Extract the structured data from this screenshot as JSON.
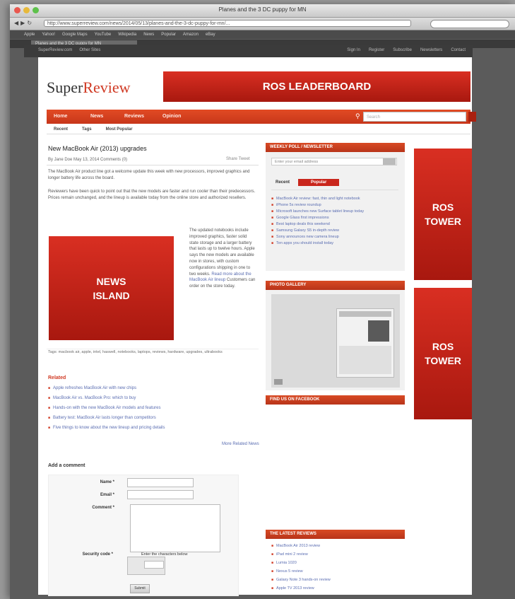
{
  "browser": {
    "window_title": "Planes and the 3 DC puppy for MN",
    "url": "http://www.superreview.com/news/2014/05/13/planes-and-the-3-dc-puppy-for-mn/...",
    "bookmarks": [
      "Apple",
      "Yahoo!",
      "Google Maps",
      "YouTube",
      "Wikipedia",
      "News",
      "Popular",
      "Amazon",
      "eBay"
    ],
    "tab_title": "Planes and the 3 DC puppy for MN"
  },
  "site_topbar": {
    "left": [
      "SuperReview.com",
      "Other Sites"
    ],
    "right": [
      "Sign In",
      "Register",
      "Subscribe",
      "Newsletters",
      "Contact"
    ]
  },
  "logo": {
    "part1": "Super",
    "part2": "Review"
  },
  "leaderboard": {
    "label": "ROS LEADERBOARD"
  },
  "nav": {
    "items": [
      "Home",
      "News",
      "Reviews",
      "Opinion"
    ],
    "search_placeholder": "Search",
    "search_icon": "search-icon",
    "sub_items": [
      "Recent",
      "Tags",
      "Most Popular"
    ]
  },
  "article": {
    "title": "New MacBook Air (2013) upgrades",
    "byline": "By Jane Doe   May 13, 2014   Comments (0)",
    "share": "Share  Tweet",
    "para1": "The MacBook Air product line got a welcome update this week with new processors, improved graphics and longer battery life across the board.",
    "para2": "Reviewers have been quick to point out that the new models are faster and run cooler than their predecessors. Prices remain unchanged, and the lineup is available today from the online store and authorized resellers.",
    "island_line1": "NEWS",
    "island_line2": "ISLAND",
    "side_text": "The updated notebooks include improved graphics, faster solid state storage and a larger battery that lasts up to twelve hours. Apple says the new models are available now in stores, with custom configurations shipping in one to two weeks.",
    "side_link": "Read more about the MacBook Air lineup",
    "side_tail": "Customers can order on the store today.",
    "tags": "Tags: macbook air, apple, intel, haswell, notebooks, laptops, reviews, hardware, upgrades, ultrabooks"
  },
  "related": {
    "heading": "Related",
    "links": [
      "Apple refreshes MacBook Air with new chips",
      "MacBook Air vs. MacBook Pro: which to buy",
      "Hands-on with the new MacBook Air models and features",
      "Battery test: MacBook Air lasts longer than competitors",
      "Five things to know about the new lineup and pricing details"
    ],
    "more": "More Related News"
  },
  "comments": {
    "heading": "Add a comment",
    "name_label": "Name *",
    "email_label": "Email *",
    "comment_label": "Comment *",
    "captcha_label": "Security code *",
    "captcha_hint": "Enter the characters below",
    "submit": "Submit"
  },
  "sidebar": {
    "poll": {
      "heading": "WEEKLY POLL / NEWSLETTER",
      "input_placeholder": "Enter your email address",
      "tab_inactive": "Recent",
      "tab_active": "Popular",
      "items": [
        "MacBook Air review: fast, thin and light notebook",
        "iPhone 5s review roundup",
        "Microsoft launches new Surface tablet lineup today",
        "Google Glass first impressions",
        "Best laptop deals this weekend",
        "Samsung Galaxy S5 in-depth review",
        "Sony announces new camera lineup",
        "Ten apps you should install today"
      ]
    },
    "gallery": {
      "heading": "PHOTO GALLERY"
    },
    "facebook": {
      "heading": "FIND US ON FACEBOOK"
    },
    "reviews": {
      "heading": "THE LATEST REVIEWS",
      "items": [
        "MacBook Air 2013 review",
        "iPad mini 2 review",
        "Lumia 1020",
        "Nexus 5 review",
        "Galaxy Note 3 hands-on review",
        "Apple TV 2013 review"
      ]
    }
  },
  "towers": {
    "label_line1": "ROS",
    "label_line2": "TOWER"
  },
  "colors": {
    "brand_red": "#c9261c",
    "nav_orange": "#e24b24",
    "link_blue": "#5a6db1"
  }
}
